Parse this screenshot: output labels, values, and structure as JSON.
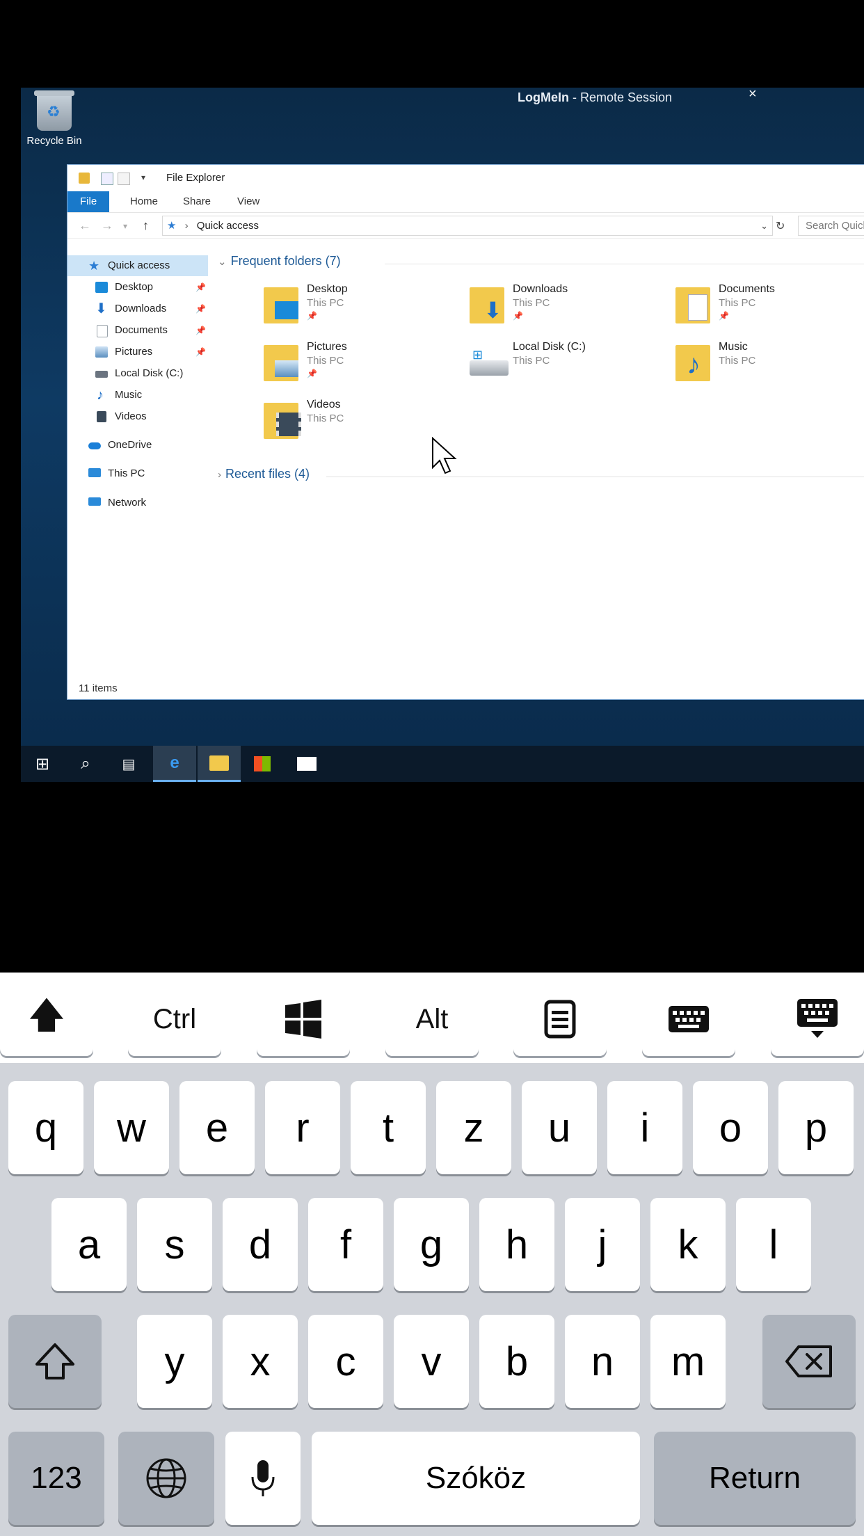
{
  "session": {
    "brand": "LogMeIn",
    "title_rest": " - Remote Session",
    "close": "×"
  },
  "desktop": {
    "recycle_bin_label": "Recycle Bin"
  },
  "explorer": {
    "window_title": "File Explorer",
    "ribbon_tabs": [
      "File",
      "Home",
      "Share",
      "View"
    ],
    "address": "Quick access",
    "search_placeholder": "Search Quick access",
    "nav": [
      {
        "label": "Quick access",
        "icon": "star-icon",
        "color": "#2b7cd3"
      },
      {
        "label": "Desktop",
        "icon": "desktop-folder-icon",
        "color": "#1a8ad9",
        "pinned": true
      },
      {
        "label": "Downloads",
        "icon": "download-arrow-icon",
        "color": "#1e6fc7",
        "pinned": true
      },
      {
        "label": "Documents",
        "icon": "documents-icon",
        "color": "#9aa3ab",
        "pinned": true
      },
      {
        "label": "Pictures",
        "icon": "pictures-icon",
        "color": "#5a8fbf",
        "pinned": true
      },
      {
        "label": "Local Disk (C:)",
        "icon": "drive-icon",
        "color": "#6b7480"
      },
      {
        "label": "Music",
        "icon": "music-note-icon",
        "color": "#1e6fc7"
      },
      {
        "label": "Videos",
        "icon": "videos-icon",
        "color": "#3a4a5a"
      },
      {
        "label": "OneDrive",
        "icon": "cloud-icon",
        "color": "#1a7fd8"
      },
      {
        "label": "This PC",
        "icon": "computer-icon",
        "color": "#2a8ad9"
      },
      {
        "label": "Network",
        "icon": "network-icon",
        "color": "#2a8ad9"
      }
    ],
    "frequent_header": "Frequent folders (7)",
    "folders": [
      {
        "name": "Desktop",
        "location": "This PC",
        "pinned": true,
        "icon": "desktop-folder-icon"
      },
      {
        "name": "Downloads",
        "location": "This PC",
        "pinned": true,
        "icon": "downloads-folder-icon"
      },
      {
        "name": "Documents",
        "location": "This PC",
        "pinned": true,
        "icon": "documents-folder-icon"
      },
      {
        "name": "Pictures",
        "location": "This PC",
        "pinned": true,
        "icon": "pictures-folder-icon"
      },
      {
        "name": "Local Disk (C:)",
        "location": "This PC",
        "pinned": false,
        "icon": "drive-icon"
      },
      {
        "name": "Music",
        "location": "This PC",
        "pinned": false,
        "icon": "music-folder-icon"
      },
      {
        "name": "Videos",
        "location": "This PC",
        "pinned": false,
        "icon": "videos-folder-icon"
      }
    ],
    "recent_header": "Recent files (4)",
    "status": "11 items",
    "pin_glyph": "📌"
  },
  "taskbar": [
    "start-icon",
    "search-icon",
    "task-view-icon",
    "edge-icon",
    "file-explorer-icon",
    "store-icon",
    "mail-icon"
  ],
  "keyboard": {
    "modifiers": [
      "shift-arrow-icon",
      "Ctrl",
      "windows-icon",
      "Alt",
      "menu-icon",
      "keyboard-icon",
      "hide-keyboard-icon"
    ],
    "row1": [
      "q",
      "w",
      "e",
      "r",
      "t",
      "z",
      "u",
      "i",
      "o",
      "p"
    ],
    "row2": [
      "a",
      "s",
      "d",
      "f",
      "g",
      "h",
      "j",
      "k",
      "l"
    ],
    "row3": [
      "y",
      "x",
      "c",
      "v",
      "b",
      "n",
      "m"
    ],
    "numbers_label": "123",
    "space_label": "Szóköz",
    "return_label": "Return"
  }
}
